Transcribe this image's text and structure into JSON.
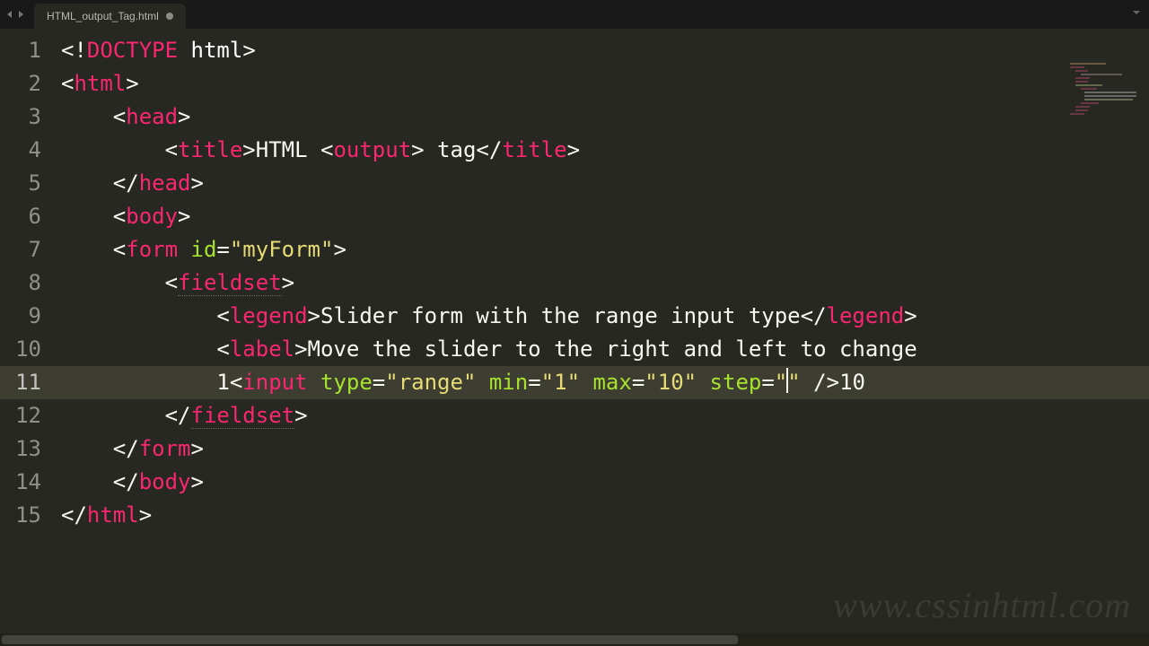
{
  "tab": {
    "title": "HTML_output_Tag.html",
    "dirty": true
  },
  "watermark": "www.cssinhtml.com",
  "gutter": {
    "count": 15,
    "active": 11
  },
  "code": {
    "lines": [
      {
        "indent": 0,
        "tokens": [
          {
            "t": "<!",
            "c": "bracket"
          },
          {
            "t": "DOCTYPE",
            "c": "doctype"
          },
          {
            "t": " ",
            "c": "text"
          },
          {
            "t": "html",
            "c": "wht"
          },
          {
            "t": ">",
            "c": "bracket"
          }
        ]
      },
      {
        "indent": 0,
        "tokens": [
          {
            "t": "<",
            "c": "bracket"
          },
          {
            "t": "html",
            "c": "tag"
          },
          {
            "t": ">",
            "c": "bracket"
          }
        ]
      },
      {
        "indent": 1,
        "tokens": [
          {
            "t": "<",
            "c": "bracket"
          },
          {
            "t": "head",
            "c": "tag"
          },
          {
            "t": ">",
            "c": "bracket"
          }
        ]
      },
      {
        "indent": 2,
        "tokens": [
          {
            "t": "<",
            "c": "bracket"
          },
          {
            "t": "title",
            "c": "tag"
          },
          {
            "t": ">",
            "c": "bracket"
          },
          {
            "t": "HTML <",
            "c": "text"
          },
          {
            "t": "output",
            "c": "tag"
          },
          {
            "t": "> tag",
            "c": "text"
          },
          {
            "t": "</",
            "c": "bracket"
          },
          {
            "t": "title",
            "c": "tag"
          },
          {
            "t": ">",
            "c": "bracket"
          }
        ]
      },
      {
        "indent": 1,
        "tokens": [
          {
            "t": "</",
            "c": "bracket"
          },
          {
            "t": "head",
            "c": "tag"
          },
          {
            "t": ">",
            "c": "bracket"
          }
        ]
      },
      {
        "indent": 1,
        "tokens": [
          {
            "t": "<",
            "c": "bracket"
          },
          {
            "t": "body",
            "c": "tag"
          },
          {
            "t": ">",
            "c": "bracket"
          }
        ]
      },
      {
        "indent": 1,
        "tokens": [
          {
            "t": "<",
            "c": "bracket"
          },
          {
            "t": "form",
            "c": "tag"
          },
          {
            "t": " ",
            "c": "text"
          },
          {
            "t": "id",
            "c": "attr"
          },
          {
            "t": "=",
            "c": "punct"
          },
          {
            "t": "\"myForm\"",
            "c": "string"
          },
          {
            "t": ">",
            "c": "bracket"
          }
        ]
      },
      {
        "indent": 2,
        "tokens": [
          {
            "t": "<",
            "c": "bracket"
          },
          {
            "t": "fieldset",
            "c": "tag",
            "u": true
          },
          {
            "t": ">",
            "c": "bracket"
          }
        ]
      },
      {
        "indent": 3,
        "tokens": [
          {
            "t": "<",
            "c": "bracket"
          },
          {
            "t": "legend",
            "c": "tag"
          },
          {
            "t": ">",
            "c": "bracket"
          },
          {
            "t": "Slider form with the range input type",
            "c": "text"
          },
          {
            "t": "</",
            "c": "bracket"
          },
          {
            "t": "legend",
            "c": "tag"
          },
          {
            "t": ">",
            "c": "bracket"
          }
        ]
      },
      {
        "indent": 3,
        "tokens": [
          {
            "t": "<",
            "c": "bracket"
          },
          {
            "t": "label",
            "c": "tag"
          },
          {
            "t": ">",
            "c": "bracket"
          },
          {
            "t": "Move the slider to the right and left to change",
            "c": "text"
          }
        ]
      },
      {
        "indent": 3,
        "active": true,
        "tokens": [
          {
            "t": "1",
            "c": "text"
          },
          {
            "t": "<",
            "c": "bracket"
          },
          {
            "t": "input",
            "c": "tag"
          },
          {
            "t": " ",
            "c": "text"
          },
          {
            "t": "type",
            "c": "attr"
          },
          {
            "t": "=",
            "c": "punct"
          },
          {
            "t": "\"range\"",
            "c": "string"
          },
          {
            "t": " ",
            "c": "text"
          },
          {
            "t": "min",
            "c": "attr"
          },
          {
            "t": "=",
            "c": "punct"
          },
          {
            "t": "\"1\"",
            "c": "string"
          },
          {
            "t": " ",
            "c": "text"
          },
          {
            "t": "max",
            "c": "attr"
          },
          {
            "t": "=",
            "c": "punct"
          },
          {
            "t": "\"10\"",
            "c": "string"
          },
          {
            "t": " ",
            "c": "text"
          },
          {
            "t": "step",
            "c": "attr"
          },
          {
            "t": "=",
            "c": "punct"
          },
          {
            "t": "\"",
            "c": "string"
          },
          {
            "cursor": true
          },
          {
            "t": "\"",
            "c": "string"
          },
          {
            "t": " ",
            "c": "text"
          },
          {
            "t": "/>",
            "c": "bracket"
          },
          {
            "t": "10",
            "c": "text"
          }
        ]
      },
      {
        "indent": 2,
        "tokens": [
          {
            "t": "</",
            "c": "bracket"
          },
          {
            "t": "fieldset",
            "c": "tag",
            "u": true
          },
          {
            "t": ">",
            "c": "bracket"
          }
        ]
      },
      {
        "indent": 1,
        "tokens": [
          {
            "t": "</",
            "c": "bracket"
          },
          {
            "t": "form",
            "c": "tag"
          },
          {
            "t": ">",
            "c": "bracket"
          }
        ]
      },
      {
        "indent": 1,
        "tokens": [
          {
            "t": "</",
            "c": "bracket"
          },
          {
            "t": "body",
            "c": "tag"
          },
          {
            "t": ">",
            "c": "bracket"
          }
        ]
      },
      {
        "indent": 0,
        "tokens": [
          {
            "t": "</",
            "c": "bracket"
          },
          {
            "t": "html",
            "c": "tag"
          },
          {
            "t": ">",
            "c": "bracket"
          }
        ]
      }
    ]
  }
}
